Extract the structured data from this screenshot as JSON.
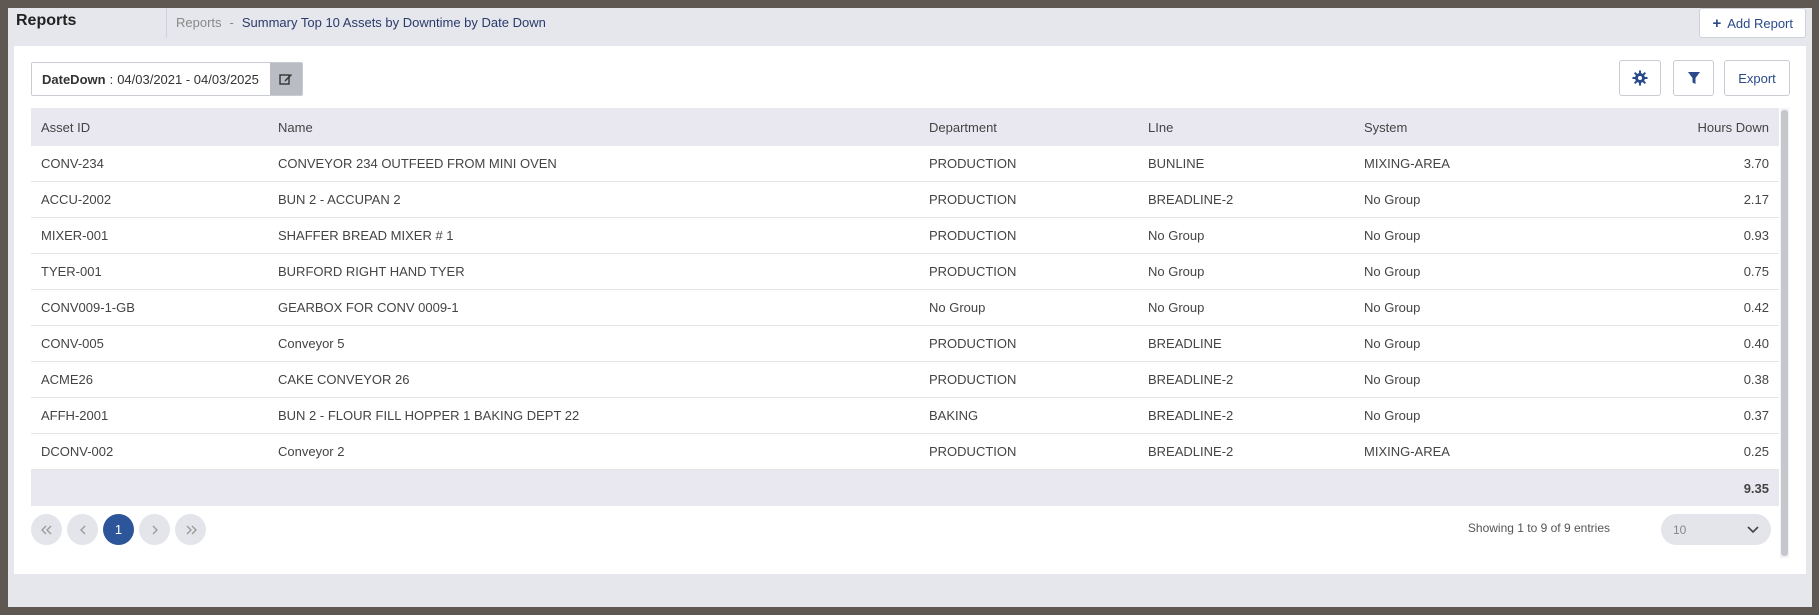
{
  "header": {
    "title": "Reports",
    "breadcrumb_root": "Reports",
    "breadcrumb_sep": "-",
    "breadcrumb_current": "Summary Top 10 Assets by Downtime by Date Down",
    "add_report_label": "Add Report"
  },
  "filter": {
    "label": "DateDown",
    "separator": ":",
    "value": "04/03/2021 - 04/03/2025"
  },
  "toolbar": {
    "settings_icon": "gear-icon",
    "filter_icon": "funnel-icon",
    "export_label": "Export"
  },
  "table": {
    "columns": [
      "Asset ID",
      "Name",
      "Department",
      "LIne",
      "System",
      "Hours Down"
    ],
    "rows": [
      [
        "CONV-234",
        "CONVEYOR 234 OUTFEED FROM MINI OVEN",
        "PRODUCTION",
        "BUNLINE",
        "MIXING-AREA",
        "3.70"
      ],
      [
        "ACCU-2002",
        "BUN 2 - ACCUPAN 2",
        "PRODUCTION",
        "BREADLINE-2",
        "No Group",
        "2.17"
      ],
      [
        "MIXER-001",
        "SHAFFER BREAD MIXER # 1",
        "PRODUCTION",
        "No Group",
        "No Group",
        "0.93"
      ],
      [
        "TYER-001",
        "BURFORD RIGHT HAND TYER",
        "PRODUCTION",
        "No Group",
        "No Group",
        "0.75"
      ],
      [
        "CONV009-1-GB",
        "GEARBOX FOR CONV 0009-1",
        "No Group",
        "No Group",
        "No Group",
        "0.42"
      ],
      [
        "CONV-005",
        "Conveyor 5",
        "PRODUCTION",
        "BREADLINE",
        "No Group",
        "0.40"
      ],
      [
        "ACME26",
        "CAKE CONVEYOR 26",
        "PRODUCTION",
        "BREADLINE-2",
        "No Group",
        "0.38"
      ],
      [
        "AFFH-2001",
        "BUN 2 - FLOUR FILL HOPPER 1 BAKING DEPT 22",
        "BAKING",
        "BREADLINE-2",
        "No Group",
        "0.37"
      ],
      [
        "DCONV-002",
        "Conveyor 2",
        "PRODUCTION",
        "BREADLINE-2",
        "MIXING-AREA",
        "0.25"
      ]
    ],
    "total": "9.35"
  },
  "pagination": {
    "current_page": "1",
    "showing": "Showing 1 to 9 of 9 entries",
    "page_size": "10"
  }
}
